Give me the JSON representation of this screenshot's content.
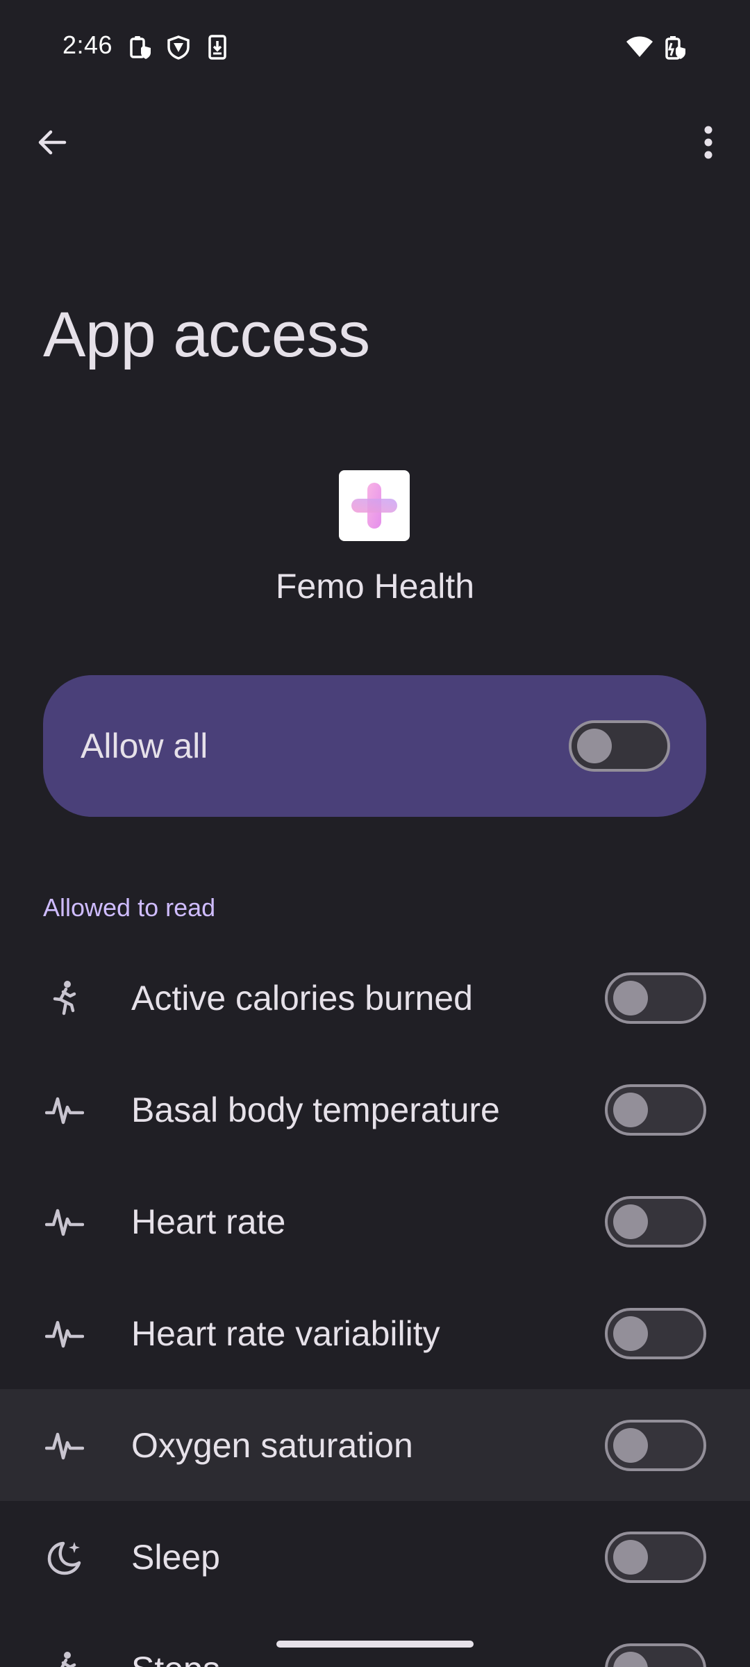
{
  "status_bar": {
    "time": "2:46",
    "icons": [
      "clipboard-shield-icon",
      "vpn-shield-icon",
      "download-icon",
      "wifi-icon",
      "battery-icon"
    ]
  },
  "top_bar": {
    "back_icon": "arrow-back-icon",
    "more_icon": "more-vert-icon"
  },
  "page": {
    "title": "App access"
  },
  "app": {
    "name": "Femo Health",
    "icon": "app-logo-icon"
  },
  "allow_all": {
    "label": "Allow all",
    "enabled": false
  },
  "section": {
    "header": "Allowed to read"
  },
  "permissions": [
    {
      "label": "Active calories burned",
      "icon": "running-icon",
      "enabled": false
    },
    {
      "label": "Basal body temperature",
      "icon": "vitals-icon",
      "enabled": false
    },
    {
      "label": "Heart rate",
      "icon": "vitals-icon",
      "enabled": false
    },
    {
      "label": "Heart rate variability",
      "icon": "vitals-icon",
      "enabled": false
    },
    {
      "label": "Oxygen saturation",
      "icon": "vitals-icon",
      "enabled": false
    },
    {
      "label": "Sleep",
      "icon": "sleep-icon",
      "enabled": false
    },
    {
      "label": "Steps",
      "icon": "running-icon",
      "enabled": false
    }
  ],
  "colors": {
    "background": "#201f25",
    "card": "#4a4079",
    "accent": "#cfbcff",
    "toggle_outline": "#938f99",
    "text": "#e6e1e9"
  }
}
